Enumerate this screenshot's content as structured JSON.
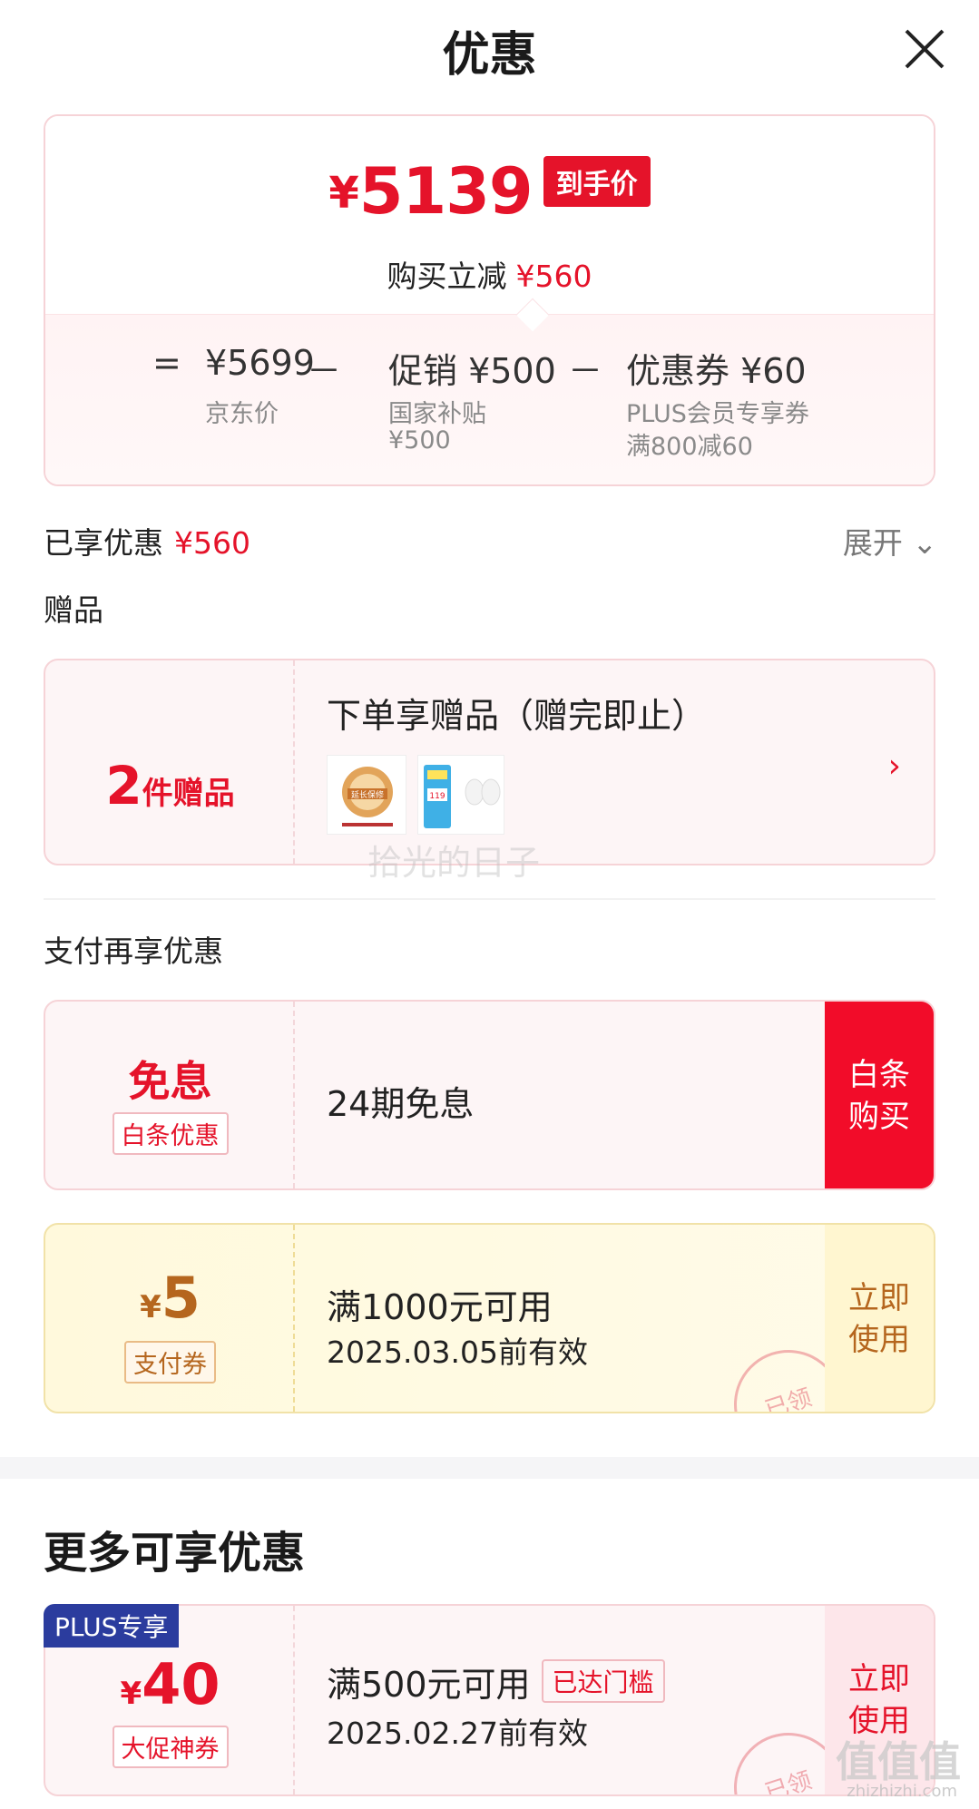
{
  "header": {
    "title": "优惠"
  },
  "summary": {
    "yen": "¥",
    "final_price": "5139",
    "final_tag": "到手价",
    "save_label": "购买立减",
    "save_amount": "¥560",
    "eq": "=",
    "minus": "－",
    "jd_price": "¥5699",
    "jd_label": "京东价",
    "promo": "促销 ¥500",
    "promo_label": "国家补贴",
    "promo_sub": "¥500",
    "coupon": "优惠券 ¥60",
    "coupon_label": "PLUS会员专享券",
    "coupon_sub": "满800减60"
  },
  "enjoyed": {
    "label": "已享优惠",
    "amount": "¥560",
    "expand": "展开 ⌄"
  },
  "gifts": {
    "section": "赠品",
    "count": "2",
    "count_unit": "件赠品",
    "title": "下单享赠品（赠完即止）",
    "arrow": "›",
    "thumb1_text": "延长保修",
    "thumb2_text": "119"
  },
  "watermark": "拾光的日子",
  "pay": {
    "section": "支付再享优惠",
    "main": "免息",
    "tag": "白条优惠",
    "text": "24期免息",
    "button": "白条\n购买"
  },
  "pay_coupon": {
    "yen": "¥",
    "amount": "5",
    "tag": "支付券",
    "condition": "满1000元可用",
    "valid": "2025.03.05前有效",
    "button": "立即\n使用",
    "stamp": "已领"
  },
  "more": {
    "title": "更多可享优惠",
    "badge": "PLUS专享",
    "yen": "¥",
    "amount": "40",
    "tag": "大促神券",
    "condition": "满500元可用",
    "reached": "已达门槛",
    "valid": "2025.02.27前有效",
    "button": "立即\n使用",
    "stamp": "已领"
  },
  "bottom_watermark": {
    "logo": "值值值",
    "url": "zhizhizhi.com"
  },
  "colors": {
    "accent": "#e5132a",
    "plus": "#2b3c9e",
    "coupon_brown": "#b5661e"
  }
}
